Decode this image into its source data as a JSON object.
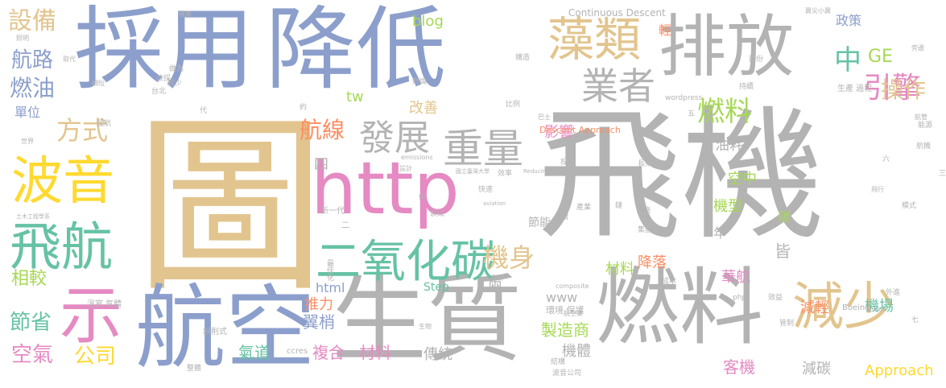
{
  "colors": {
    "blue": "#8c9fcc",
    "gray": "#b3b3b3",
    "tan": "#e2c58e",
    "pink": "#e58ac3",
    "green": "#66c2a5",
    "orange": "#fc8d62",
    "yellow": "#ffd92f",
    "lime": "#a6d854",
    "background": "#ffffff"
  },
  "words": [
    {
      "text": "飛機",
      "color": "gray"
    },
    {
      "text": "圖",
      "color": "tan"
    },
    {
      "text": "採用",
      "color": "blue"
    },
    {
      "text": "降低",
      "color": "blue"
    },
    {
      "text": "排放",
      "color": "gray"
    },
    {
      "text": "生質",
      "color": "gray"
    },
    {
      "text": "燃料",
      "color": "gray"
    },
    {
      "text": "航空",
      "color": "blue"
    },
    {
      "text": "http",
      "color": "pink"
    },
    {
      "text": "藻類",
      "color": "tan"
    },
    {
      "text": "減少",
      "color": "tan"
    },
    {
      "text": "波音",
      "color": "yellow"
    },
    {
      "text": "飛航",
      "color": "green"
    },
    {
      "text": "示",
      "color": "pink"
    },
    {
      "text": "二氧化碳",
      "color": "green"
    },
    {
      "text": "重量",
      "color": "gray"
    },
    {
      "text": "發展",
      "color": "gray"
    },
    {
      "text": "業者",
      "color": "gray"
    },
    {
      "text": "引擎",
      "color": "pink"
    },
    {
      "text": "中",
      "color": "green"
    },
    {
      "text": "燃料",
      "color": "lime"
    },
    {
      "text": "機身",
      "color": "tan"
    },
    {
      "text": "方式",
      "color": "tan"
    },
    {
      "text": "設備",
      "color": "tan"
    },
    {
      "text": "航路",
      "color": "blue"
    },
    {
      "text": "燃油",
      "color": "blue"
    },
    {
      "text": "航線",
      "color": "orange"
    },
    {
      "text": "GE",
      "color": "lime"
    },
    {
      "text": "操作",
      "color": "tan"
    },
    {
      "text": "相較",
      "color": "lime"
    },
    {
      "text": "節省",
      "color": "green"
    },
    {
      "text": "空氣",
      "color": "pink"
    },
    {
      "text": "公司",
      "color": "yellow"
    },
    {
      "text": "推力",
      "color": "orange"
    },
    {
      "text": "翼梢",
      "color": "blue"
    },
    {
      "text": "氣道",
      "color": "green"
    },
    {
      "text": "複合",
      "color": "pink"
    },
    {
      "text": "材料",
      "color": "pink"
    },
    {
      "text": "傳統",
      "color": "gray"
    },
    {
      "text": "製造商",
      "color": "lime"
    },
    {
      "text": "機體",
      "color": "gray"
    },
    {
      "text": "客機",
      "color": "pink"
    },
    {
      "text": "減碳",
      "color": "gray"
    },
    {
      "text": "Approach",
      "color": "yellow"
    },
    {
      "text": "機場",
      "color": "green"
    },
    {
      "text": "減輕",
      "color": "orange"
    },
    {
      "text": "華航",
      "color": "pink"
    },
    {
      "text": "降落",
      "color": "orange"
    },
    {
      "text": "材料",
      "color": "lime"
    },
    {
      "text": "機型",
      "color": "lime"
    },
    {
      "text": "空中",
      "color": "lime"
    },
    {
      "text": "油耗",
      "color": "gray"
    },
    {
      "text": "影響",
      "color": "pink"
    },
    {
      "text": "改善",
      "color": "tan"
    },
    {
      "text": "政策",
      "color": "blue"
    },
    {
      "text": "blog",
      "color": "lime"
    },
    {
      "text": "節能",
      "color": "gray"
    },
    {
      "text": "單位",
      "color": "blue"
    },
    {
      "text": "html",
      "color": "blue"
    },
    {
      "text": "Step",
      "color": "green"
    },
    {
      "text": "www",
      "color": "gray"
    },
    {
      "text": "tw",
      "color": "lime"
    },
    {
      "text": "四",
      "color": "gray"
    },
    {
      "text": "兩",
      "color": "gray"
    },
    {
      "text": "年",
      "color": "gray"
    },
    {
      "text": "皆",
      "color": "gray"
    },
    {
      "text": "碳",
      "color": "lime"
    },
    {
      "text": "輕",
      "color": "orange"
    },
    {
      "text": "Continuous Descent",
      "color": "gray"
    },
    {
      "text": "Descent Approach",
      "color": "orange"
    },
    {
      "text": "wordpress",
      "color": "gray"
    },
    {
      "text": "Boeing",
      "color": "gray"
    },
    {
      "text": "ccres",
      "color": "gray"
    },
    {
      "text": "php",
      "color": "gray"
    },
    {
      "text": "composite",
      "color": "gray"
    },
    {
      "text": "emissions",
      "color": "gray"
    },
    {
      "text": "aviation",
      "color": "gray"
    },
    {
      "text": "Reducing",
      "color": "gray"
    },
    {
      "text": "CFRP",
      "color": "gray"
    },
    {
      "text": "環境 保護",
      "color": "gray"
    },
    {
      "text": "生產 過程",
      "color": "gray"
    },
    {
      "text": "溫室 氣體",
      "color": "gray"
    },
    {
      "text": "國立臺灣大學",
      "color": "gray"
    },
    {
      "text": "新一代",
      "color": "gray"
    },
    {
      "text": "航空業",
      "color": "gray"
    },
    {
      "text": "波音公司",
      "color": "gray"
    },
    {
      "text": "最佳化",
      "color": "gray"
    },
    {
      "text": "斜削式",
      "color": "gray"
    },
    {
      "text": "製成",
      "color": "gray"
    },
    {
      "text": "快速",
      "color": "gray"
    },
    {
      "text": "效率",
      "color": "gray"
    },
    {
      "text": "比例",
      "color": "gray"
    },
    {
      "text": "投入",
      "color": "gray"
    },
    {
      "text": "實施",
      "color": "gray"
    },
    {
      "text": "長榮",
      "color": "gray"
    },
    {
      "text": "成本",
      "color": "gray"
    },
    {
      "text": "效益",
      "color": "gray"
    },
    {
      "text": "管制",
      "color": "gray"
    },
    {
      "text": "外進",
      "color": "gray"
    },
    {
      "text": "翼尖小翼",
      "color": "gray"
    },
    {
      "text": "做為",
      "color": "gray"
    },
    {
      "text": "較少",
      "color": "gray"
    },
    {
      "text": "台北",
      "color": "gray"
    },
    {
      "text": "改採",
      "color": "gray"
    },
    {
      "text": "取代",
      "color": "gray"
    },
    {
      "text": "細短",
      "color": "gray"
    },
    {
      "text": "照明",
      "color": "gray"
    },
    {
      "text": "能源",
      "color": "gray"
    },
    {
      "text": "航管",
      "color": "gray"
    },
    {
      "text": "航機",
      "color": "gray"
    },
    {
      "text": "旁邊",
      "color": "gray"
    },
    {
      "text": "模式",
      "color": "gray"
    },
    {
      "text": "飛行",
      "color": "gray"
    },
    {
      "text": "土木工程學系",
      "color": "gray"
    },
    {
      "text": "整體",
      "color": "gray"
    },
    {
      "text": "結構",
      "color": "gray"
    },
    {
      "text": "系統",
      "color": "gray"
    },
    {
      "text": "產業",
      "color": "gray"
    },
    {
      "text": "永續",
      "color": "gray"
    },
    {
      "text": "國航",
      "color": "gray"
    },
    {
      "text": "構造",
      "color": "gray"
    },
    {
      "text": "燃燒",
      "color": "gray"
    },
    {
      "text": "持續",
      "color": "gray"
    },
    {
      "text": "部份",
      "color": "gray"
    },
    {
      "text": "集團",
      "color": "gray"
    },
    {
      "text": "設計",
      "color": "gray"
    },
    {
      "text": "巴士",
      "color": "gray"
    },
    {
      "text": "生物",
      "color": "gray"
    },
    {
      "text": "機翼",
      "color": "gray"
    },
    {
      "text": "世界",
      "color": "gray"
    },
    {
      "text": "代",
      "color": "gray"
    },
    {
      "text": "五",
      "color": "gray"
    },
    {
      "text": "六",
      "color": "gray"
    },
    {
      "text": "七",
      "color": "gray"
    },
    {
      "text": "三",
      "color": "gray"
    },
    {
      "text": "二",
      "color": "gray"
    },
    {
      "text": "例",
      "color": "gray"
    },
    {
      "text": "約",
      "color": "gray"
    },
    {
      "text": "鏈",
      "color": "gray"
    }
  ]
}
